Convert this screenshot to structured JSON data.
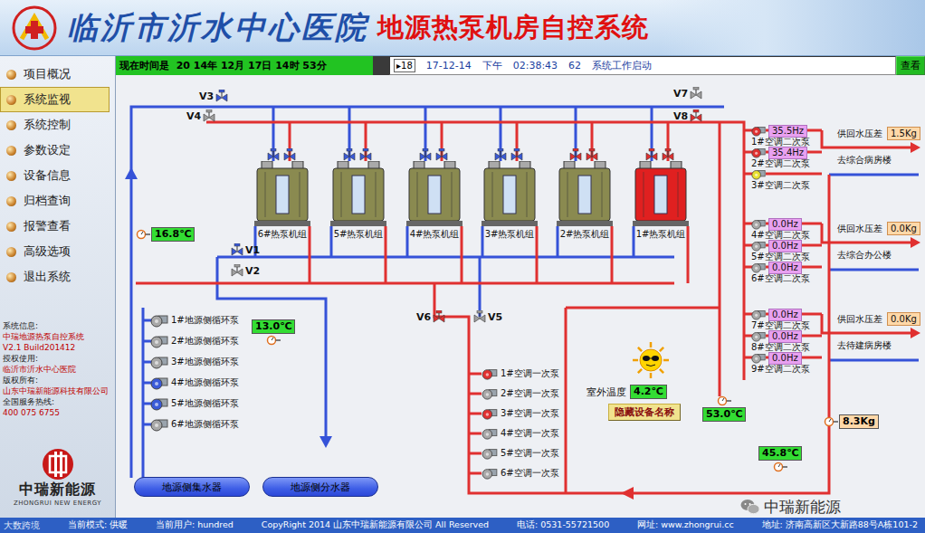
{
  "header": {
    "hospital": "临沂市沂水中心医院",
    "system": "地源热泵机房自控系统"
  },
  "sidebar": {
    "items": [
      {
        "label": "项目概况",
        "selected": false
      },
      {
        "label": "系统监视",
        "selected": true
      },
      {
        "label": "系统控制",
        "selected": false
      },
      {
        "label": "参数设定",
        "selected": false
      },
      {
        "label": "设备信息",
        "selected": false
      },
      {
        "label": "归档查询",
        "selected": false
      },
      {
        "label": "报警查看",
        "selected": false
      },
      {
        "label": "高级选项",
        "selected": false
      },
      {
        "label": "退出系统",
        "selected": false
      }
    ],
    "info": [
      {
        "heading": "系统信息:",
        "lines": [
          "中瑞地源热泵自控系统",
          "V2.1 Build201412"
        ]
      },
      {
        "heading": "授权使用:",
        "lines": [
          "临沂市沂水中心医院"
        ]
      },
      {
        "heading": "版权所有:",
        "lines": [
          "山东中瑞新能源科技有限公司"
        ]
      },
      {
        "heading": "全国服务热线:",
        "lines": [
          "400 075 6755"
        ]
      }
    ],
    "logo": {
      "name": "中瑞新能源",
      "english": "ZHONGRUI NEW ENERGY"
    }
  },
  "top_bar": {
    "clock": "现在时间是  20 14年 12月 17日 14时 53分",
    "alarm": {
      "marker": "▸18",
      "date": "17-12-14",
      "period": "下午",
      "time": "02:38:43",
      "code": "62",
      "message": "系统工作启动"
    },
    "button": "查看"
  },
  "heat_pumps": [
    {
      "label": "6#热泵机组",
      "running": false,
      "valve_color": "#3a5ad8"
    },
    {
      "label": "5#热泵机组",
      "running": false,
      "valve_color": "#3a5ad8"
    },
    {
      "label": "4#热泵机组",
      "running": false,
      "valve_color": "#3a5ad8"
    },
    {
      "label": "3#热泵机组",
      "running": false,
      "valve_color": "#3a5ad8"
    },
    {
      "label": "2#热泵机组",
      "running": false,
      "valve_color": "#e03030"
    },
    {
      "label": "1#热泵机组",
      "running": true,
      "valve_color": "#e03030"
    }
  ],
  "valves": [
    {
      "label": "V3",
      "color": "#3a5ad8"
    },
    {
      "label": "V4",
      "color": "#a0a0a0"
    },
    {
      "label": "V1",
      "color": "#3a5ad8"
    },
    {
      "label": "V2",
      "color": "#a0a0a0"
    },
    {
      "label": "V6",
      "color": "#e03030"
    },
    {
      "label": "V5",
      "color": "#a0a0a0"
    },
    {
      "label": "V7",
      "color": "#a0a0a0"
    },
    {
      "label": "V8",
      "color": "#e03030"
    }
  ],
  "ground_pumps": [
    {
      "label": "1#地源侧循环泵",
      "color": "#a8a8a8"
    },
    {
      "label": "2#地源侧循环泵",
      "color": "#a8a8a8"
    },
    {
      "label": "3#地源侧循环泵",
      "color": "#a8a8a8"
    },
    {
      "label": "4#地源侧循环泵",
      "color": "#3a5ad8"
    },
    {
      "label": "5#地源侧循环泵",
      "color": "#3a5ad8"
    },
    {
      "label": "6#地源侧循环泵",
      "color": "#a8a8a8"
    }
  ],
  "primary_pumps": [
    {
      "label": "1#空调一次泵",
      "color": "#e03030"
    },
    {
      "label": "2#空调一次泵",
      "color": "#a8a8a8"
    },
    {
      "label": "3#空调一次泵",
      "color": "#e03030"
    },
    {
      "label": "4#空调一次泵",
      "color": "#a8a8a8"
    },
    {
      "label": "5#空调一次泵",
      "color": "#a8a8a8"
    },
    {
      "label": "6#空调一次泵",
      "color": "#a8a8a8"
    }
  ],
  "secondary_groups": [
    {
      "pressure_label": "供回水压差",
      "pressure": "1.5Kg",
      "destination": "去综合病房楼",
      "pumps": [
        {
          "label": "1#空调二次泵",
          "hz": "35.5Hz",
          "color": "#e03030"
        },
        {
          "label": "2#空调二次泵",
          "hz": "35.4Hz",
          "color": "#e03030"
        },
        {
          "label": "3#空调二次泵",
          "color": "#e8e030"
        }
      ]
    },
    {
      "pressure_label": "供回水压差",
      "pressure": "0.0Kg",
      "destination": "去综合办公楼",
      "pumps": [
        {
          "label": "4#空调二次泵",
          "hz": "0.0Hz",
          "color": "#a8a8a8"
        },
        {
          "label": "5#空调二次泵",
          "hz": "0.0Hz",
          "color": "#a8a8a8"
        },
        {
          "label": "6#空调二次泵",
          "hz": "0.0Hz",
          "color": "#a8a8a8"
        }
      ]
    },
    {
      "pressure_label": "供回水压差",
      "pressure": "0.0Kg",
      "destination": "去待建病房楼",
      "pumps": [
        {
          "label": "7#空调二次泵",
          "hz": "0.0Hz",
          "color": "#a8a8a8"
        },
        {
          "label": "8#空调二次泵",
          "hz": "0.0Hz",
          "color": "#a8a8a8"
        },
        {
          "label": "9#空调二次泵",
          "hz": "0.0Hz",
          "color": "#a8a8a8"
        }
      ]
    }
  ],
  "tanks": [
    "地源侧集水器",
    "地源侧分水器"
  ],
  "sensors": [
    {
      "value": "16.8℃",
      "kind": "temperature"
    },
    {
      "value": "13.0℃",
      "kind": "temperature"
    },
    {
      "value": "53.0℃",
      "kind": "temperature"
    },
    {
      "value": "45.8℃",
      "kind": "temperature"
    },
    {
      "value": "8.3Kg",
      "kind": "pressure"
    }
  ],
  "outdoor": {
    "label": "室外温度",
    "value": "4.2℃"
  },
  "hide_button": "隐藏设备名称",
  "watermark": {
    "wechat": "中瑞新能源",
    "corner": "大数跨境"
  },
  "status_bar": {
    "mode": "当前模式: 供暖",
    "user": "当前用户: hundred",
    "copyright": "CopyRight 2014 山东中瑞新能源有限公司 All Reserved",
    "phone": "电话: 0531-55721500",
    "website": "网址: www.zhongrui.cc",
    "address": "地址: 济南高新区大新路88号A栋101-2"
  }
}
